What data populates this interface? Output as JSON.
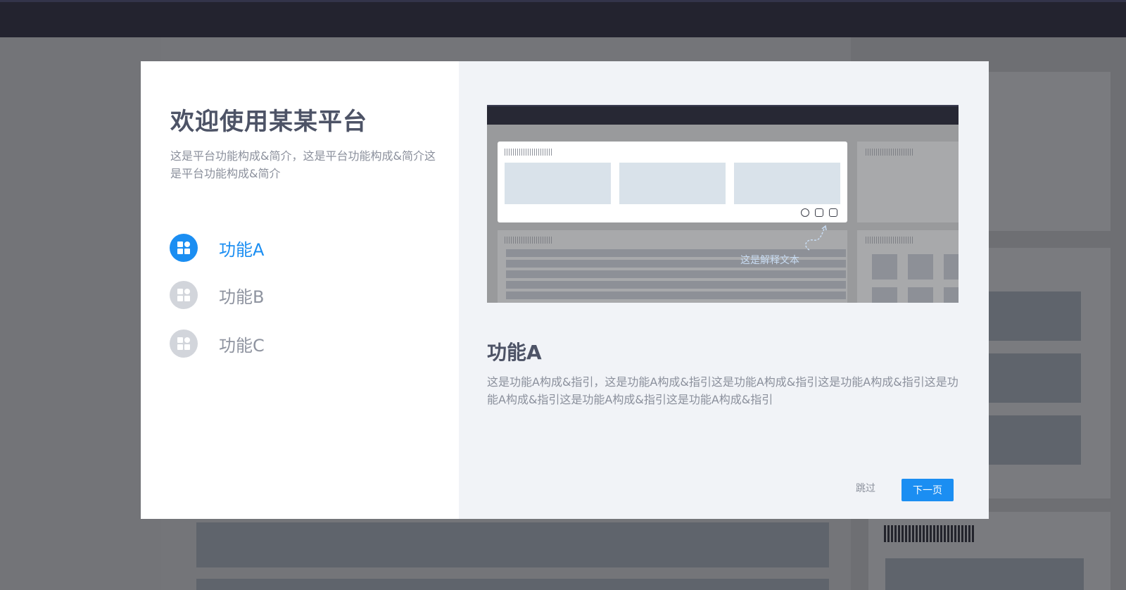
{
  "welcome": {
    "title": "欢迎使用某某平台",
    "description": "这是平台功能构成&简介，这是平台功能构成&简介这是平台功能构成&简介"
  },
  "features": [
    {
      "label": "功能A",
      "icon": "grid-icon",
      "active": true
    },
    {
      "label": "功能B",
      "icon": "grid-icon",
      "active": false
    },
    {
      "label": "功能C",
      "icon": "grid-icon",
      "active": false
    }
  ],
  "preview": {
    "annotation": "这是解释文本",
    "tool_icons": [
      "gear-icon",
      "ai-icon",
      "edit-icon"
    ]
  },
  "detail": {
    "title": "功能A",
    "description": "这是功能A构成&指引，这是功能A构成&指引这是功能A构成&指引这是功能A构成&指引这是功能A构成&指引这是功能A构成&指引这是功能A构成&指引"
  },
  "buttons": {
    "skip": "跳过",
    "next": "下一页"
  },
  "colors": {
    "accent": "#1b8ef2",
    "inactive_icon": "#d2d5db",
    "topbar": "#23232f"
  }
}
